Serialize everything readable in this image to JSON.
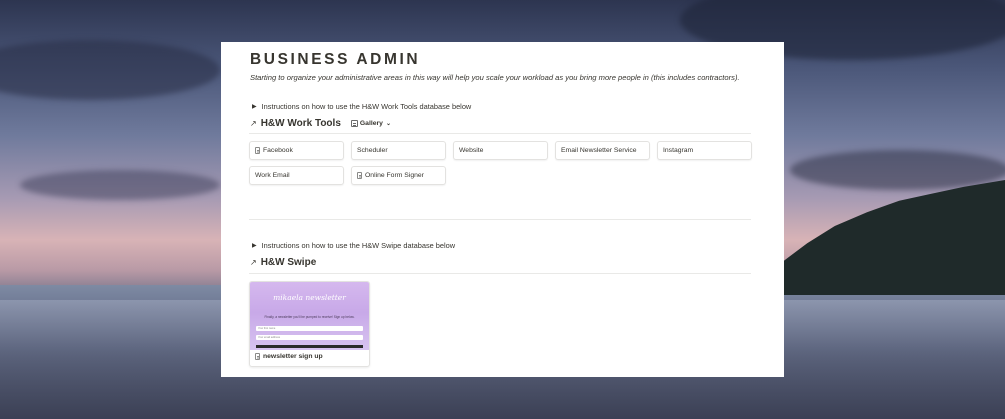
{
  "page": {
    "title": "BUSINESS ADMIN",
    "subtitle": "Starting to organize your administrative areas in this way will help you scale your workload as you bring more people in (this includes contractors)."
  },
  "work_tools": {
    "toggle_text": "Instructions on how to use the H&W Work Tools database below",
    "arrow": "↗",
    "title": "H&W Work Tools",
    "view_label": "Gallery",
    "view_icon": "gallery-icon",
    "cards": [
      {
        "label": "Facebook",
        "icon": "document-icon"
      },
      {
        "label": "Scheduler",
        "icon": ""
      },
      {
        "label": "Website",
        "icon": ""
      },
      {
        "label": "Email Newsletter Service",
        "icon": ""
      },
      {
        "label": "Instagram",
        "icon": ""
      },
      {
        "label": "Work Email",
        "icon": ""
      },
      {
        "label": "Online Form Signer",
        "icon": "document-icon"
      }
    ]
  },
  "swipe": {
    "toggle_text": "Instructions on how to use the H&W Swipe database below",
    "arrow": "↗",
    "title": "H&W Swipe",
    "card": {
      "name": "newsletter sign up",
      "preview_title": "mikaela newsletter",
      "preview_text": "Finally, a newsletter you'll be pumped to receive! Sign up below.",
      "preview_field_1": "Your first name",
      "preview_field_2": "Your email address"
    }
  },
  "colors": {
    "text": "#37352f",
    "border": "#e3e2e0",
    "card_gradient_top": "#d5b8ee"
  }
}
